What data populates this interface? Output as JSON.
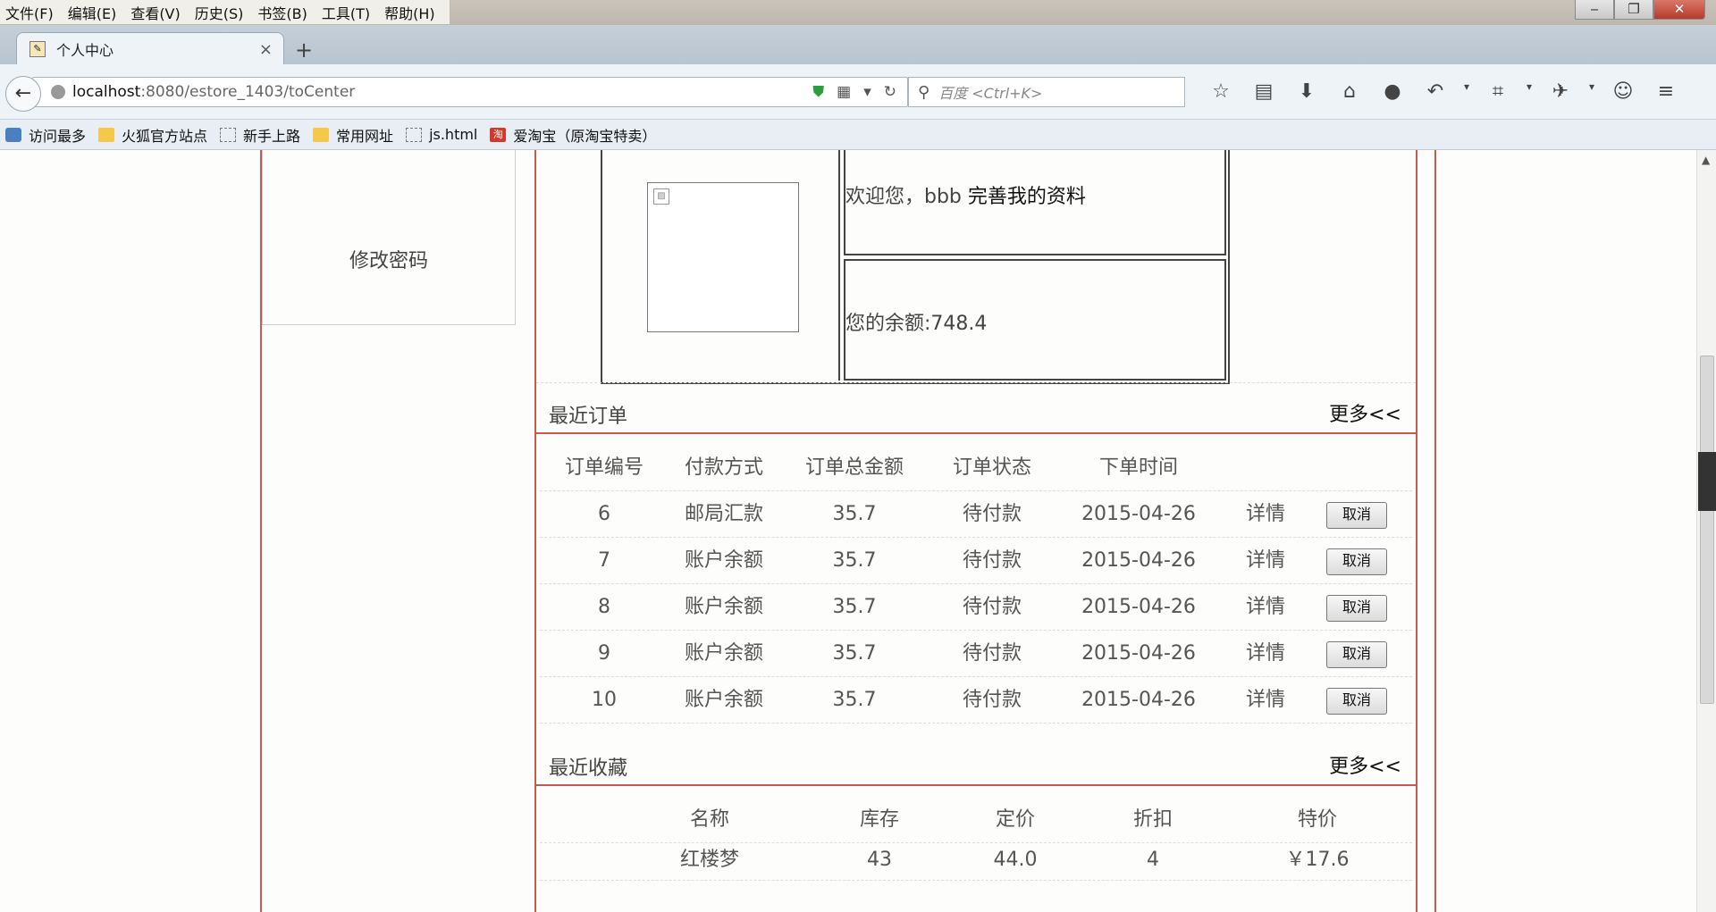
{
  "menubar": [
    "文件(F)",
    "编辑(E)",
    "查看(V)",
    "历史(S)",
    "书签(B)",
    "工具(T)",
    "帮助(H)"
  ],
  "window_controls": {
    "minimize": "‒",
    "maximize": "❐",
    "close": "✕"
  },
  "tab": {
    "title": "个人中心",
    "close": "×",
    "new_tab": "+"
  },
  "url": {
    "host": "localhost",
    "path": ":8080/estore_1403/toCenter"
  },
  "search": {
    "placeholder": "百度 <Ctrl+K>"
  },
  "bookmarks": [
    "访问最多",
    "火狐官方站点",
    "新手上路",
    "常用网址",
    "js.html",
    "爱淘宝（原淘宝特卖）"
  ],
  "sidebar": {
    "change_password": "修改密码"
  },
  "profile": {
    "welcome_prefix": "欢迎您，bbb ",
    "complete_profile_link": "完善我的资料",
    "balance_text": "您的余额:748.4"
  },
  "recent_orders": {
    "title": "最近订单",
    "more": "更多<<",
    "headers": [
      "订单编号",
      "付款方式",
      "订单总金额",
      "订单状态",
      "下单时间"
    ],
    "detail_label": "详情",
    "cancel_label": "取消",
    "rows": [
      [
        "6",
        "邮局汇款",
        "35.7",
        "待付款",
        "2015-04-26"
      ],
      [
        "7",
        "账户余额",
        "35.7",
        "待付款",
        "2015-04-26"
      ],
      [
        "8",
        "账户余额",
        "35.7",
        "待付款",
        "2015-04-26"
      ],
      [
        "9",
        "账户余额",
        "35.7",
        "待付款",
        "2015-04-26"
      ],
      [
        "10",
        "账户余额",
        "35.7",
        "待付款",
        "2015-04-26"
      ]
    ]
  },
  "recent_favorites": {
    "title": "最近收藏",
    "more": "更多<<",
    "headers": [
      "名称",
      "库存",
      "定价",
      "折扣",
      "特价"
    ],
    "rows": [
      [
        "红楼梦",
        "43",
        "44.0",
        "4",
        "￥17.6"
      ]
    ]
  },
  "colors": {
    "accent_border": "#c9584f"
  }
}
